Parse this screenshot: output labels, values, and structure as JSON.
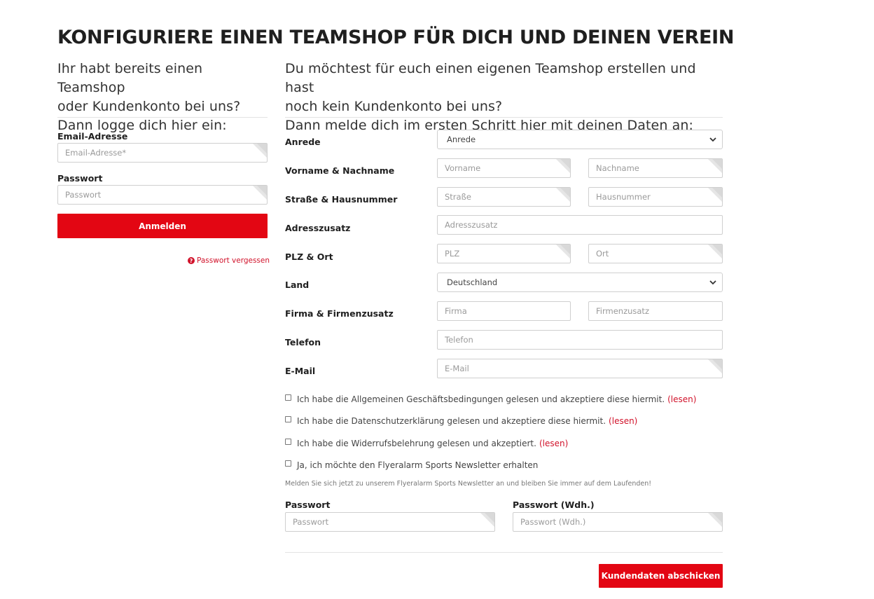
{
  "title": "KONFIGURIERE EINEN TEAMSHOP FÜR DICH UND DEINEN VEREIN",
  "login": {
    "intro": [
      "Ihr habt bereits einen Teamshop",
      "oder Kundenkonto bei uns?",
      "Dann logge dich hier ein:"
    ],
    "email_label": "Email-Adresse",
    "email_placeholder": "Email-Adresse*",
    "password_label": "Passwort",
    "password_placeholder": "Passwort",
    "submit_label": "Anmelden",
    "forgot_label": "Passwort vergessen"
  },
  "register": {
    "intro": [
      "Du möchtest für euch einen eigenen Teamshop erstellen und hast",
      "noch kein Kundenkonto bei uns?",
      "Dann melde dich im ersten Schritt hier mit deinen Daten an:"
    ],
    "rows": {
      "salutation": {
        "label": "Anrede",
        "value": "Anrede"
      },
      "name": {
        "label": "Vorname & Nachname",
        "first_placeholder": "Vorname",
        "last_placeholder": "Nachname"
      },
      "street": {
        "label": "Straße & Hausnummer",
        "street_placeholder": "Straße",
        "number_placeholder": "Hausnummer"
      },
      "address_extra": {
        "label": "Adresszusatz",
        "placeholder": "Adresszusatz"
      },
      "zip_city": {
        "label": "PLZ & Ort",
        "zip_placeholder": "PLZ",
        "city_placeholder": "Ort"
      },
      "country": {
        "label": "Land",
        "value": "Deutschland"
      },
      "company": {
        "label": "Firma & Firmenzusatz",
        "company_placeholder": "Firma",
        "extra_placeholder": "Firmenzusatz"
      },
      "phone": {
        "label": "Telefon",
        "placeholder": "Telefon"
      },
      "email": {
        "label": "E-Mail",
        "placeholder": "E-Mail"
      }
    },
    "checkboxes": [
      {
        "text": "Ich habe die Allgemeinen Geschäftsbedingungen gelesen und akzeptiere diese hiermit.",
        "link": "(lesen)"
      },
      {
        "text": "Ich habe die Datenschutzerklärung gelesen und akzeptiere diese hiermit.",
        "link": "(lesen)"
      },
      {
        "text": "Ich habe die Widerrufsbelehrung gelesen und akzeptiert.",
        "link": "(lesen)"
      },
      {
        "text": "Ja, ich möchte den Flyeralarm Sports Newsletter erhalten",
        "link": ""
      }
    ],
    "newsletter_note": "Melden Sie sich jetzt zu unserem Flyeralarm Sports Newsletter an und bleiben Sie immer auf dem Laufenden!",
    "password_label": "Passwort",
    "password_placeholder": "Passwort",
    "password_repeat_label": "Passwort (Wdh.)",
    "password_repeat_placeholder": "Passwort (Wdh.)",
    "submit_label": "Kundendaten abschicken"
  },
  "colors": {
    "accent": "#e30613",
    "link": "#d1122a"
  }
}
